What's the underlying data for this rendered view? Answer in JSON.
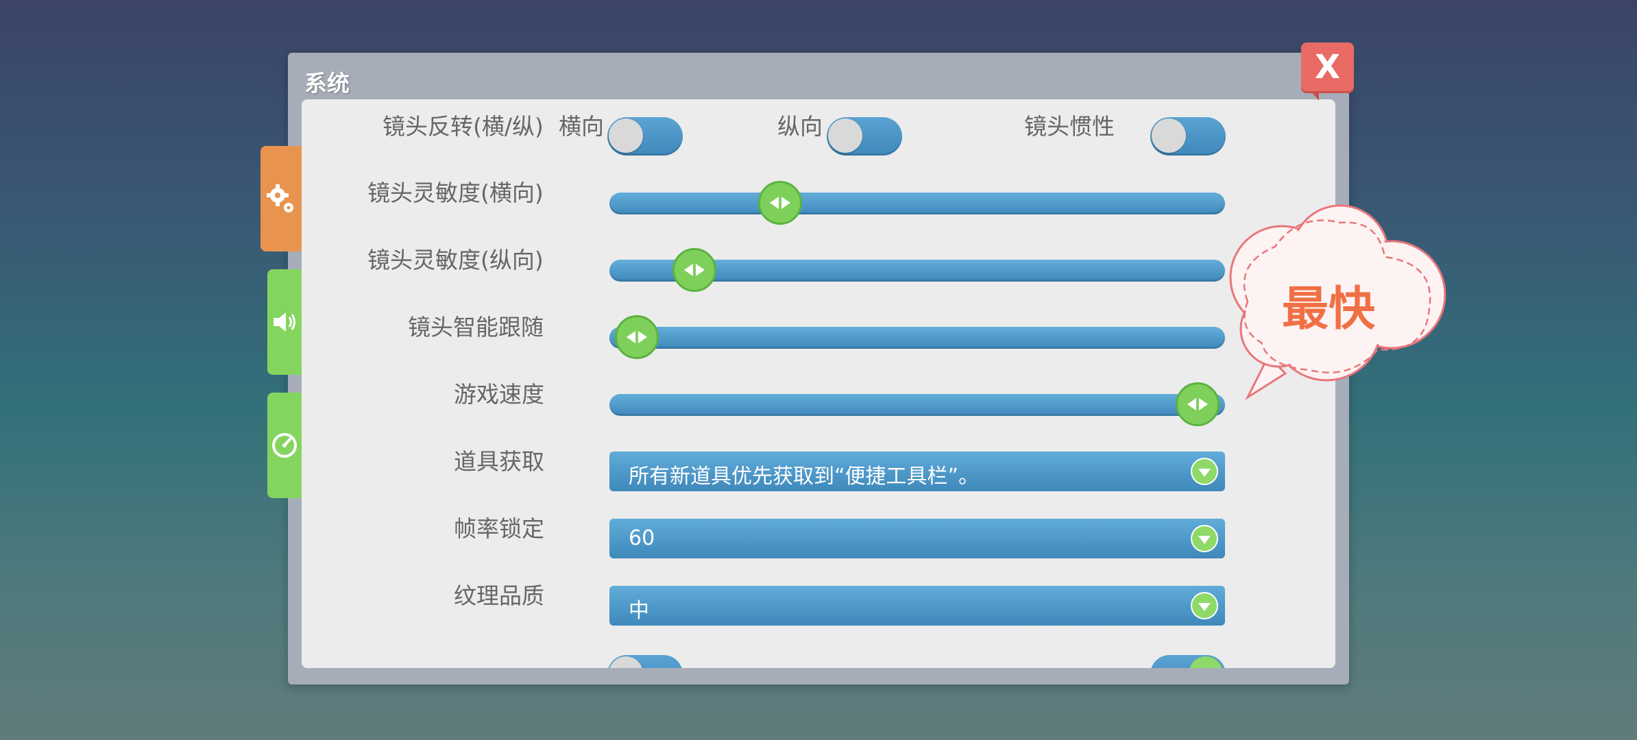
{
  "panel": {
    "title": "系统",
    "close_label": "X"
  },
  "tabs": [
    {
      "name": "general",
      "icon": "gears-icon",
      "active": true
    },
    {
      "name": "sound",
      "icon": "speaker-icon",
      "active": false
    },
    {
      "name": "performance",
      "icon": "gauge-icon",
      "active": false
    }
  ],
  "settings": {
    "camera_invert_label": "镜头反转(横/纵)",
    "horizontal_label": "横向",
    "vertical_label": "纵向",
    "camera_inertia_label": "镜头惯性",
    "sens_h_label": "镜头灵敏度(横向)",
    "sens_v_label": "镜头灵敏度(纵向)",
    "smart_follow_label": "镜头智能跟随",
    "game_speed_label": "游戏速度",
    "item_pickup_label": "道具获取",
    "item_pickup_value": "所有新道具优先获取到“便捷工具栏”。",
    "fps_lock_label": "帧率锁定",
    "fps_lock_value": "60",
    "texture_label": "纹理品质",
    "texture_value": "中"
  },
  "sliders": {
    "sens_h": 0.26,
    "sens_v": 0.11,
    "smart_follow": 0.01,
    "game_speed": 0.99
  },
  "tooltip": {
    "text": "最快"
  },
  "colors": {
    "accent_blue": "#4a93c5",
    "thumb_green": "#7fd05b",
    "close_red": "#e86b65",
    "tooltip_orange": "#f07045"
  }
}
